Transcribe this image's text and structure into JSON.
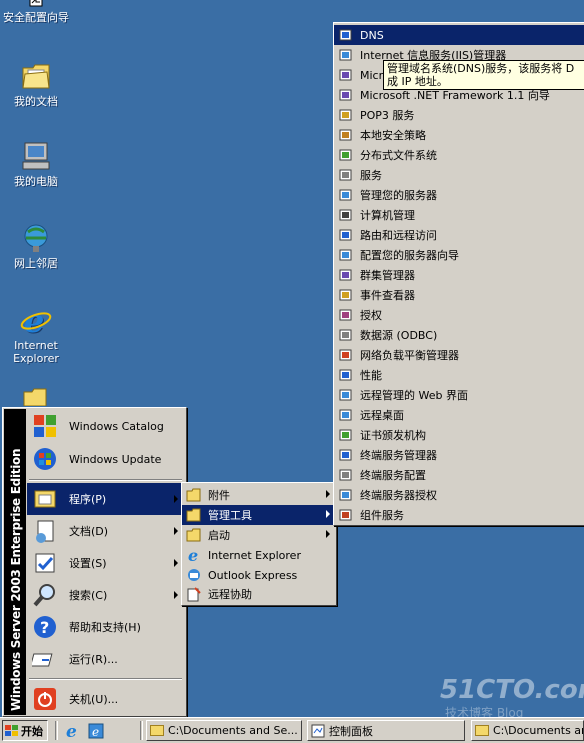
{
  "desktop": {
    "icons": [
      {
        "label": "安全配置向导",
        "icon": "security-wizard-icon"
      },
      {
        "label": "我的文档",
        "icon": "my-documents-icon"
      },
      {
        "label": "我的电脑",
        "icon": "my-computer-icon"
      },
      {
        "label": "网上邻居",
        "icon": "network-places-icon"
      },
      {
        "label": "Internet Explorer",
        "icon": "internet-explorer-icon"
      }
    ]
  },
  "start_menu": {
    "brand": "Windows Server 2003 Enterprise Edition",
    "pinned": [
      {
        "label": "Windows Catalog",
        "icon": "windows-catalog-icon"
      },
      {
        "label": "Windows Update",
        "icon": "windows-update-icon"
      }
    ],
    "items": [
      {
        "label": "程序(P)",
        "icon": "programs-icon",
        "submenu": true,
        "selected": true
      },
      {
        "label": "文档(D)",
        "icon": "documents-icon",
        "submenu": true
      },
      {
        "label": "设置(S)",
        "icon": "settings-icon",
        "submenu": true
      },
      {
        "label": "搜索(C)",
        "icon": "search-icon",
        "submenu": true
      },
      {
        "label": "帮助和支持(H)",
        "icon": "help-icon"
      },
      {
        "label": "运行(R)...",
        "icon": "run-icon"
      }
    ],
    "shutdown": {
      "label": "关机(U)...",
      "icon": "shutdown-icon"
    }
  },
  "programs_menu": {
    "items": [
      {
        "label": "附件",
        "icon": "folder-icon",
        "submenu": true
      },
      {
        "label": "管理工具",
        "icon": "folder-icon",
        "submenu": true,
        "selected": true
      },
      {
        "label": "启动",
        "icon": "folder-icon",
        "submenu": true
      },
      {
        "label": "Internet Explorer",
        "icon": "internet-explorer-icon"
      },
      {
        "label": "Outlook Express",
        "icon": "outlook-express-icon"
      },
      {
        "label": "远程协助",
        "icon": "remote-assistance-icon"
      }
    ]
  },
  "admin_tools_menu": {
    "items": [
      {
        "label": "DNS",
        "icon": "dns-icon",
        "selected": true
      },
      {
        "label": "Internet 信息服务(IIS)管理器",
        "icon": "iis-icon"
      },
      {
        "label": "Microsoft .NET Framework 1.1 配置",
        "icon": "dotnet-icon"
      },
      {
        "label": "Microsoft .NET Framework 1.1 向导",
        "icon": "dotnet-icon"
      },
      {
        "label": "POP3 服务",
        "icon": "pop3-icon"
      },
      {
        "label": "本地安全策略",
        "icon": "security-policy-icon"
      },
      {
        "label": "分布式文件系统",
        "icon": "dfs-icon"
      },
      {
        "label": "服务",
        "icon": "services-icon"
      },
      {
        "label": "管理您的服务器",
        "icon": "manage-server-icon"
      },
      {
        "label": "计算机管理",
        "icon": "computer-management-icon"
      },
      {
        "label": "路由和远程访问",
        "icon": "routing-icon"
      },
      {
        "label": "配置您的服务器向导",
        "icon": "configure-server-icon"
      },
      {
        "label": "群集管理器",
        "icon": "cluster-icon"
      },
      {
        "label": "事件查看器",
        "icon": "event-viewer-icon"
      },
      {
        "label": "授权",
        "icon": "licensing-icon"
      },
      {
        "label": "数据源 (ODBC)",
        "icon": "odbc-icon"
      },
      {
        "label": "网络负载平衡管理器",
        "icon": "nlb-icon"
      },
      {
        "label": "性能",
        "icon": "performance-icon"
      },
      {
        "label": "远程管理的 Web 界面",
        "icon": "web-admin-icon"
      },
      {
        "label": "远程桌面",
        "icon": "remote-desktop-icon"
      },
      {
        "label": "证书颁发机构",
        "icon": "certificate-icon"
      },
      {
        "label": "终端服务管理器",
        "icon": "terminal-services-icon"
      },
      {
        "label": "终端服务配置",
        "icon": "terminal-config-icon"
      },
      {
        "label": "终端服务器授权",
        "icon": "terminal-licensing-icon"
      },
      {
        "label": "组件服务",
        "icon": "component-services-icon"
      }
    ]
  },
  "tooltip": {
    "line1": "管理域名系统(DNS)服务，该服务将 D",
    "line2": "成 IP 地址。"
  },
  "taskbar": {
    "start_label": "开始",
    "tasks": [
      {
        "label": "C:\\Documents and Se...",
        "icon": "folder-icon"
      },
      {
        "label": "控制面板",
        "icon": "control-panel-icon"
      },
      {
        "label": "C:\\Documents an",
        "icon": "folder-icon"
      }
    ]
  },
  "watermark": {
    "main": "51CTO.com",
    "sub": "技术博客  Blog"
  },
  "colors": {
    "desktop": "#3a6ea5",
    "selection": "#0a246a",
    "menu": "#d4d0c8"
  }
}
